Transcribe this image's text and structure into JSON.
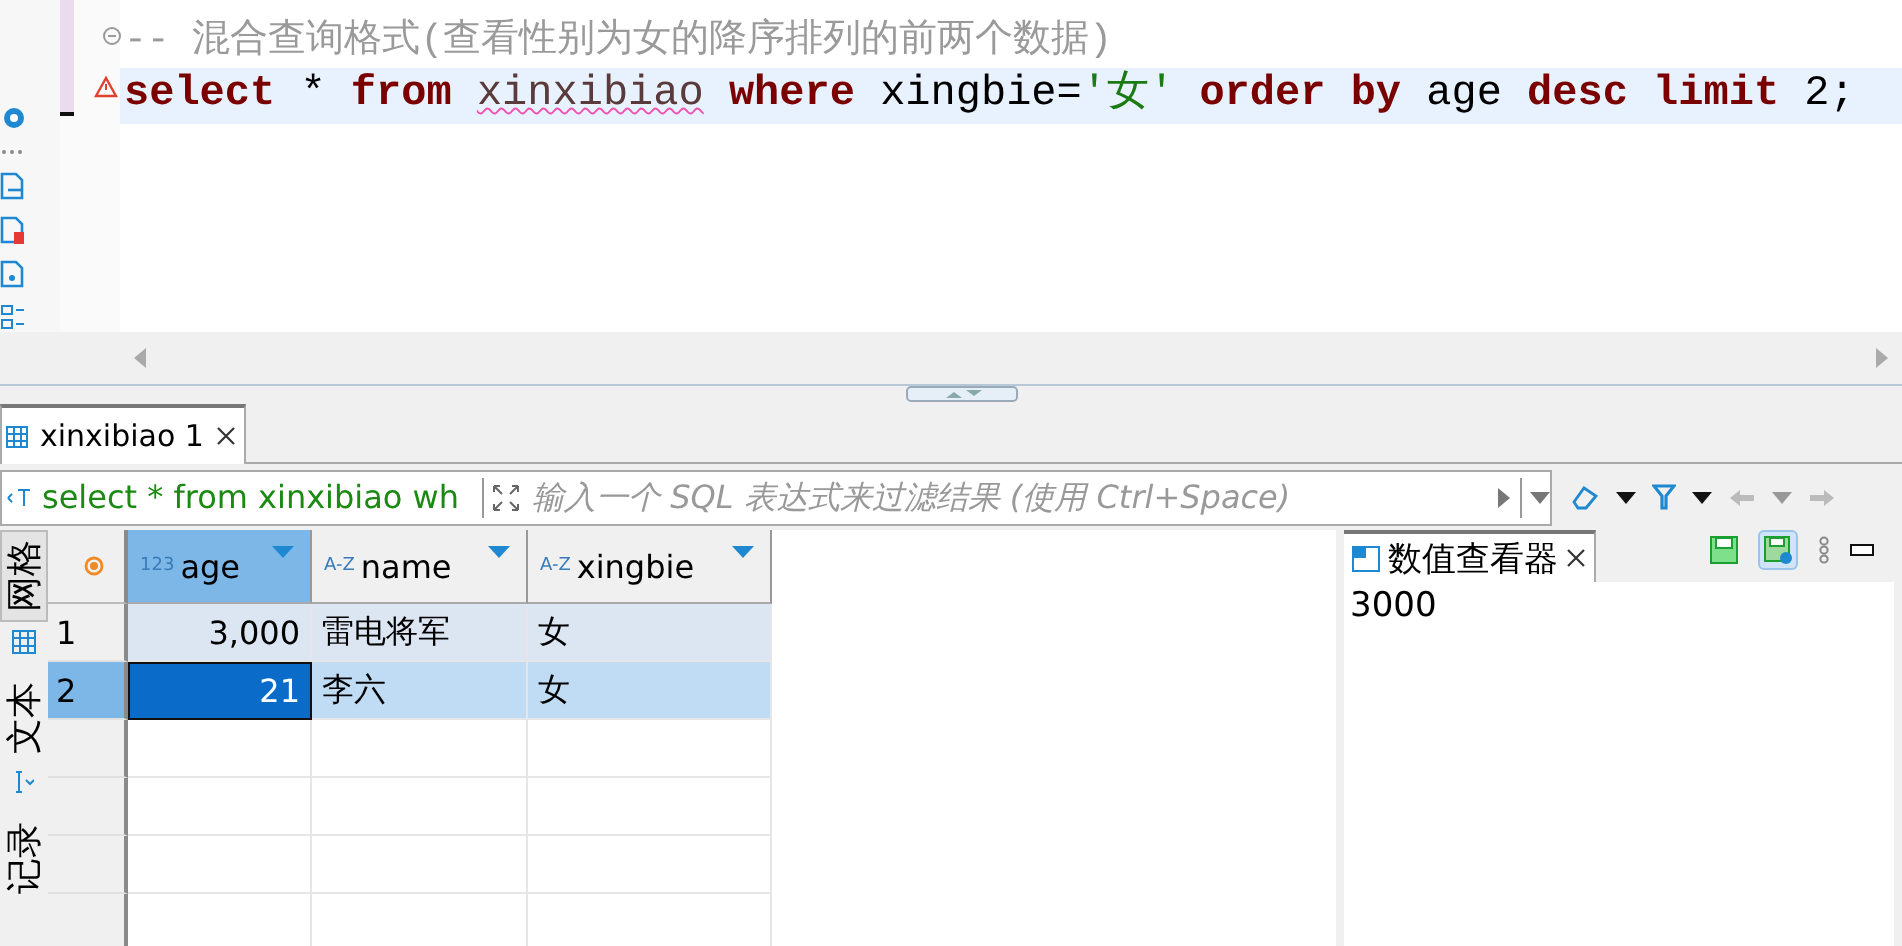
{
  "editor": {
    "lines": [
      {
        "current": false,
        "tokens": [
          {
            "kind": "comment",
            "text": "-- 混合查询格式(查看性别为女的降序排列的前两个数据)"
          }
        ]
      },
      {
        "current": true,
        "tokens": [
          {
            "kind": "keyword",
            "text": "select"
          },
          {
            "kind": "plain",
            "text": "*"
          },
          {
            "kind": "keyword",
            "text": "from"
          },
          {
            "kind": "table",
            "text": "xinxibiao"
          },
          {
            "kind": "keyword",
            "text": "where"
          },
          {
            "kind": "plain",
            "text": "xingbie="
          },
          {
            "kind": "string",
            "text": "'女'",
            "joined": true
          },
          {
            "kind": "keyword",
            "text": "order by"
          },
          {
            "kind": "plain",
            "text": "age"
          },
          {
            "kind": "keyword",
            "text": "desc"
          },
          {
            "kind": "keyword",
            "text": "limit"
          },
          {
            "kind": "plain",
            "text": "2;"
          }
        ]
      }
    ]
  },
  "results_tab": {
    "label": "xinxibiao 1"
  },
  "filter": {
    "query": "select * from xinxibiao wh",
    "placeholder": "输入一个 SQL 表达式来过滤结果 (使用 Ctrl+Space)"
  },
  "side_tabs": [
    {
      "label": "网格",
      "selected": true
    },
    {
      "label": "文本",
      "selected": false
    },
    {
      "label": "记录",
      "selected": false
    }
  ],
  "table": {
    "columns": [
      {
        "name": "age",
        "type_label": "123",
        "selected": true
      },
      {
        "name": "name",
        "type_label": "A-Z",
        "selected": false
      },
      {
        "name": "xingbie",
        "type_label": "A-Z",
        "selected": false
      }
    ],
    "rows": [
      {
        "number": "1",
        "selected": false,
        "cells": [
          "3,000",
          "雷电将军",
          "女"
        ]
      },
      {
        "number": "2",
        "selected": true,
        "cells": [
          "21",
          "李六",
          "女"
        ]
      }
    ]
  },
  "value_viewer": {
    "title": "数值查看器",
    "value": "3000"
  }
}
